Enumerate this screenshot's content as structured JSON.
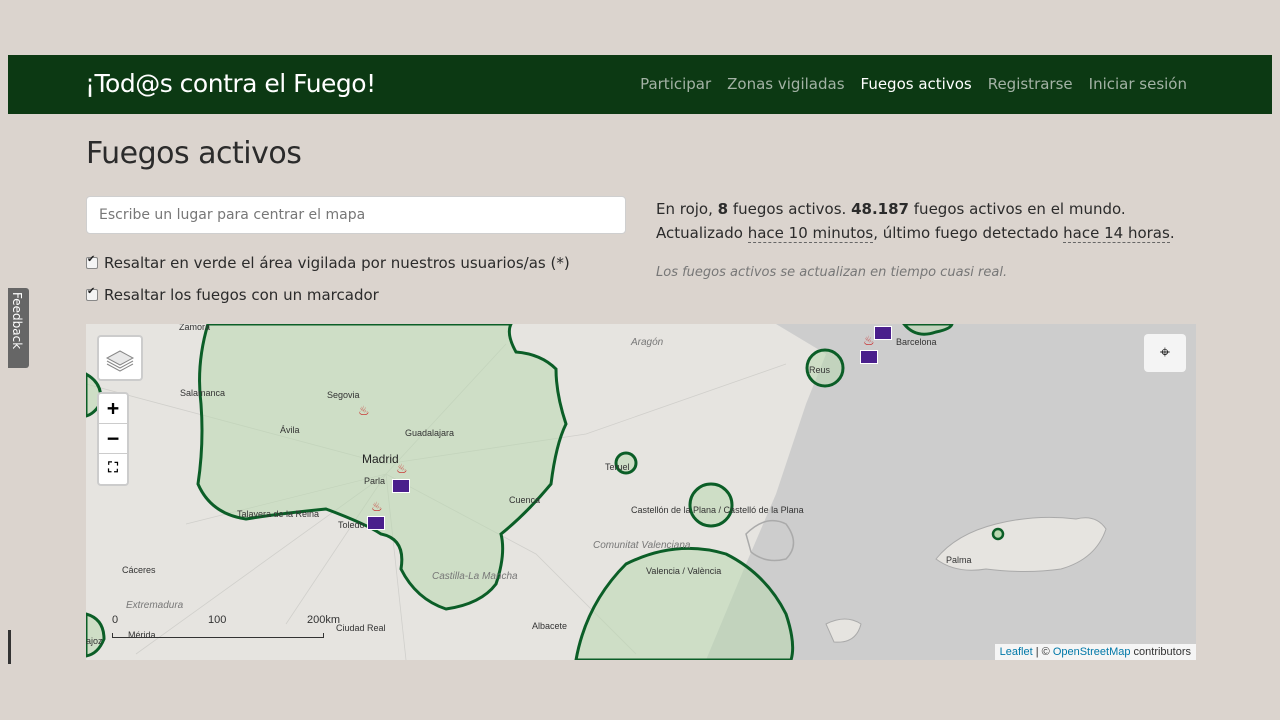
{
  "navbar": {
    "brand": "¡Tod@s contra el Fuego!",
    "items": [
      {
        "label": "Participar"
      },
      {
        "label": "Zonas vigiladas"
      },
      {
        "label": "Fuegos activos"
      },
      {
        "label": "Registrarse"
      },
      {
        "label": "Iniciar sesión"
      }
    ],
    "active": "Fuegos activos"
  },
  "page": {
    "title": "Fuegos activos"
  },
  "search": {
    "placeholder": "Escribe un lugar para centrar el mapa",
    "value": ""
  },
  "options": {
    "highlight_area_label": "Resaltar en verde el área vigilada por nuestros usuarios/as (*)",
    "highlight_area_checked": true,
    "highlight_fires_label": "Resaltar los fuegos con un marcador",
    "highlight_fires_checked": true
  },
  "info": {
    "prefix": "En rojo,",
    "active_count": "8",
    "active_text": "fuegos activos.",
    "world_count": "48.187",
    "world_text": "fuegos activos en el mundo.",
    "updated_prefix": "Actualizado",
    "updated_ago": "hace 10 minutos",
    "last_prefix": ", último fuego detectado",
    "last_ago": "hace 14 horas",
    "last_suffix": ".",
    "note": "Los fuegos activos se actualizan en tiempo cuasi real."
  },
  "feedback": {
    "label": "Feedback"
  },
  "map": {
    "places": [
      {
        "name": "Zamora"
      },
      {
        "name": "Aragón"
      },
      {
        "name": "Barcelona"
      },
      {
        "name": "Salamanca"
      },
      {
        "name": "Segovia"
      },
      {
        "name": "Reus"
      },
      {
        "name": "Ávila"
      },
      {
        "name": "Guadalajara"
      },
      {
        "name": "Madrid"
      },
      {
        "name": "Teruel"
      },
      {
        "name": "Parla"
      },
      {
        "name": "Cuenca"
      },
      {
        "name": "Talavera de la Reina"
      },
      {
        "name": "Toledo"
      },
      {
        "name": "Castellón de la Plana / Castelló de la Plana"
      },
      {
        "name": "Comunitat Valenciana"
      },
      {
        "name": "Cáceres"
      },
      {
        "name": "Castilla-La Mancha"
      },
      {
        "name": "Valencia / València"
      },
      {
        "name": "Palma"
      },
      {
        "name": "Extremadura"
      },
      {
        "name": "Mérida"
      },
      {
        "name": "Ciudad Real"
      },
      {
        "name": "Albacete"
      },
      {
        "name": "ajoz"
      }
    ],
    "zoom_in": "+",
    "zoom_out": "−",
    "fullscreen_icon": "fullscreen-icon",
    "layers_icon": "layers-icon",
    "locate_icon": "locate-icon",
    "scale": {
      "t0": "0",
      "t1": "100",
      "t2": "200km"
    },
    "attribution": {
      "leaflet": "Leaflet",
      "sep": " | © ",
      "osm": "OpenStreetMap",
      "suffix": " contributors"
    },
    "colors": {
      "zone_fill": "#b9d8b0",
      "zone_stroke": "#0b5e27",
      "sea": "#cdcdcd",
      "land": "#e6e4e0",
      "fire": "#c81e1e",
      "factory": "#4a1f8c"
    }
  }
}
